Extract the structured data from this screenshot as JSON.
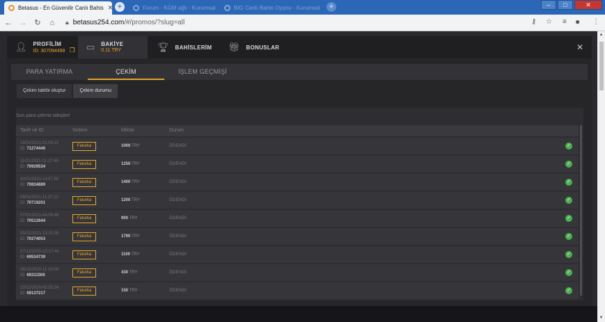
{
  "browser": {
    "tabs": [
      {
        "title": "Betasus - En Güvenilir Canlı Bahis",
        "active": true
      },
      {
        "title": "Forum - KGM ağlı - Kurumsal",
        "active": false
      },
      {
        "title": "BIG Canlı Bahis Oyunu - Kurumsal",
        "active": false
      }
    ],
    "new_tab": "+",
    "url_host": "betasus254.com",
    "url_path": "/#/promos/?slug=all"
  },
  "modal": {
    "header": {
      "profile_label": "PROFİLİM",
      "profile_id": "ID: 307094498",
      "balance_label": "BAKİYE",
      "balance_value": "0.11 TRY",
      "bets_label": "BAHİSLERİM",
      "bonuses_label": "BONUSLAR",
      "close": "✕"
    },
    "subtabs": [
      "PARA YATIRMA",
      "ÇEKİM",
      "İŞLEM GEÇMİŞİ"
    ],
    "actions": [
      "Çekim talebi oluştur",
      "Çekim durumu"
    ],
    "panel_title": "Son para çekme talepleri",
    "columns": [
      "Tarih ve ID",
      "Sistem",
      "Miktar",
      "Durum"
    ],
    "fatura_label": "Faturka",
    "currency": "TRY",
    "rows": [
      {
        "date": "15/01/2021-01:54:21",
        "id": "71274446",
        "amount": "1000",
        "status": "ÖDENDİ"
      },
      {
        "date": "11/01/2021-21:27:40",
        "id": "70929534",
        "amount": "1250",
        "status": "ÖDENDİ"
      },
      {
        "date": "10/01/2021-14:57:50",
        "id": "70834889",
        "amount": "1400",
        "status": "ÖDENDİ"
      },
      {
        "date": "09/01/2021-11:27:12",
        "id": "70719201",
        "amount": "1200",
        "status": "ÖDENDİ"
      },
      {
        "date": "07/01/2021-04:09:49",
        "id": "70512644",
        "amount": "900",
        "status": "ÖDENDİ"
      },
      {
        "date": "05/01/2021-23:31:05",
        "id": "70274053",
        "amount": "1790",
        "status": "ÖDENDİ"
      },
      {
        "date": "27/12/2020-15:17:44",
        "id": "69534739",
        "amount": "1100",
        "status": "ÖDENDİ"
      },
      {
        "date": "25/12/2020-11:19:09",
        "id": "69311500",
        "amount": "430",
        "status": "ÖDENDİ"
      },
      {
        "date": "23/12/2020-02:53:24",
        "id": "69137217",
        "amount": "150",
        "status": "ÖDENDİ"
      }
    ]
  },
  "colors": {
    "accent": "#e7a52b",
    "paid": "#4caf50",
    "modal_bg": "#262629",
    "browser_blue": "#2b67b6"
  }
}
